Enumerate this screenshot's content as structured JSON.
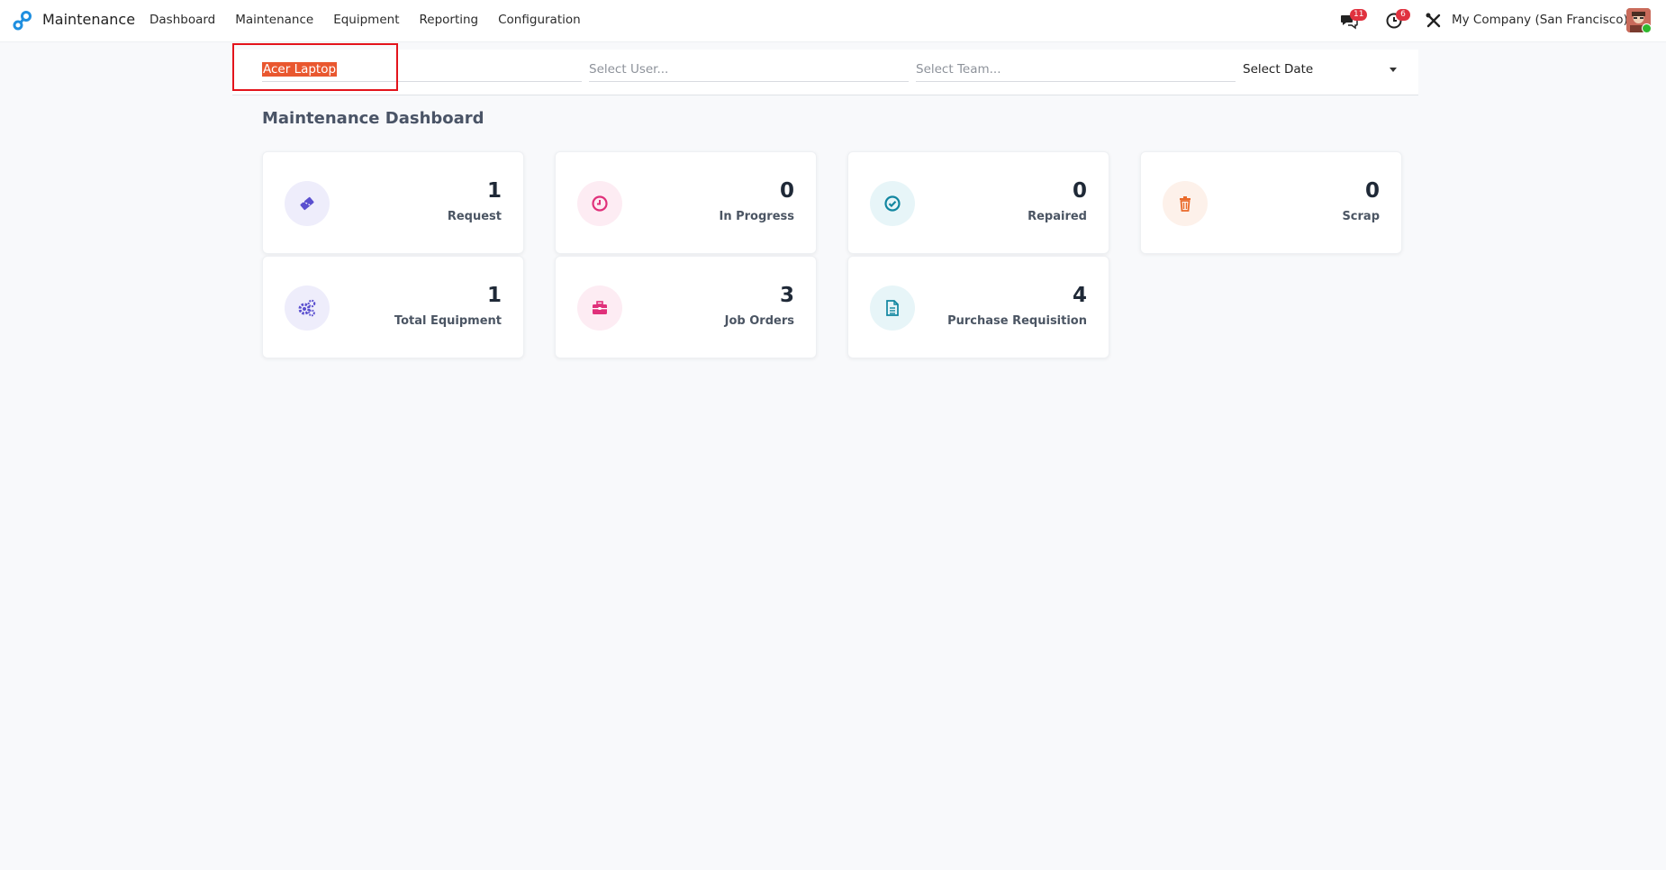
{
  "app": {
    "name": "Maintenance"
  },
  "menu": [
    "Dashboard",
    "Maintenance",
    "Equipment",
    "Reporting",
    "Configuration"
  ],
  "systray": {
    "messages_count": "11",
    "activities_count": "6",
    "company": "My Company (San Francisco)"
  },
  "filters": {
    "equipment_value": "Acer Laptop",
    "user_placeholder": "Select User...",
    "team_placeholder": "Select Team...",
    "date_value": "Select Date"
  },
  "dashboard": {
    "title": "Maintenance Dashboard",
    "cards": [
      {
        "value": "1",
        "label": "Request",
        "icon": "ticket-icon",
        "color": "#5a4fcf",
        "bg": "#eeedfb"
      },
      {
        "value": "0",
        "label": "In Progress",
        "icon": "clock-icon",
        "color": "#e0307a",
        "bg": "#fdecf3"
      },
      {
        "value": "0",
        "label": "Repaired",
        "icon": "check-circle-icon",
        "color": "#1186a0",
        "bg": "#e7f5f8"
      },
      {
        "value": "0",
        "label": "Scrap",
        "icon": "trash-icon",
        "color": "#ea6a2a",
        "bg": "#fdf1ea"
      },
      {
        "value": "1",
        "label": "Total Equipment",
        "icon": "gears-icon",
        "color": "#5a4fcf",
        "bg": "#eeedfb"
      },
      {
        "value": "3",
        "label": "Job Orders",
        "icon": "briefcase-icon",
        "color": "#e0307a",
        "bg": "#fdecf3"
      },
      {
        "value": "4",
        "label": "Purchase Requisition",
        "icon": "document-icon",
        "color": "#1186a0",
        "bg": "#e7f5f8"
      }
    ]
  }
}
